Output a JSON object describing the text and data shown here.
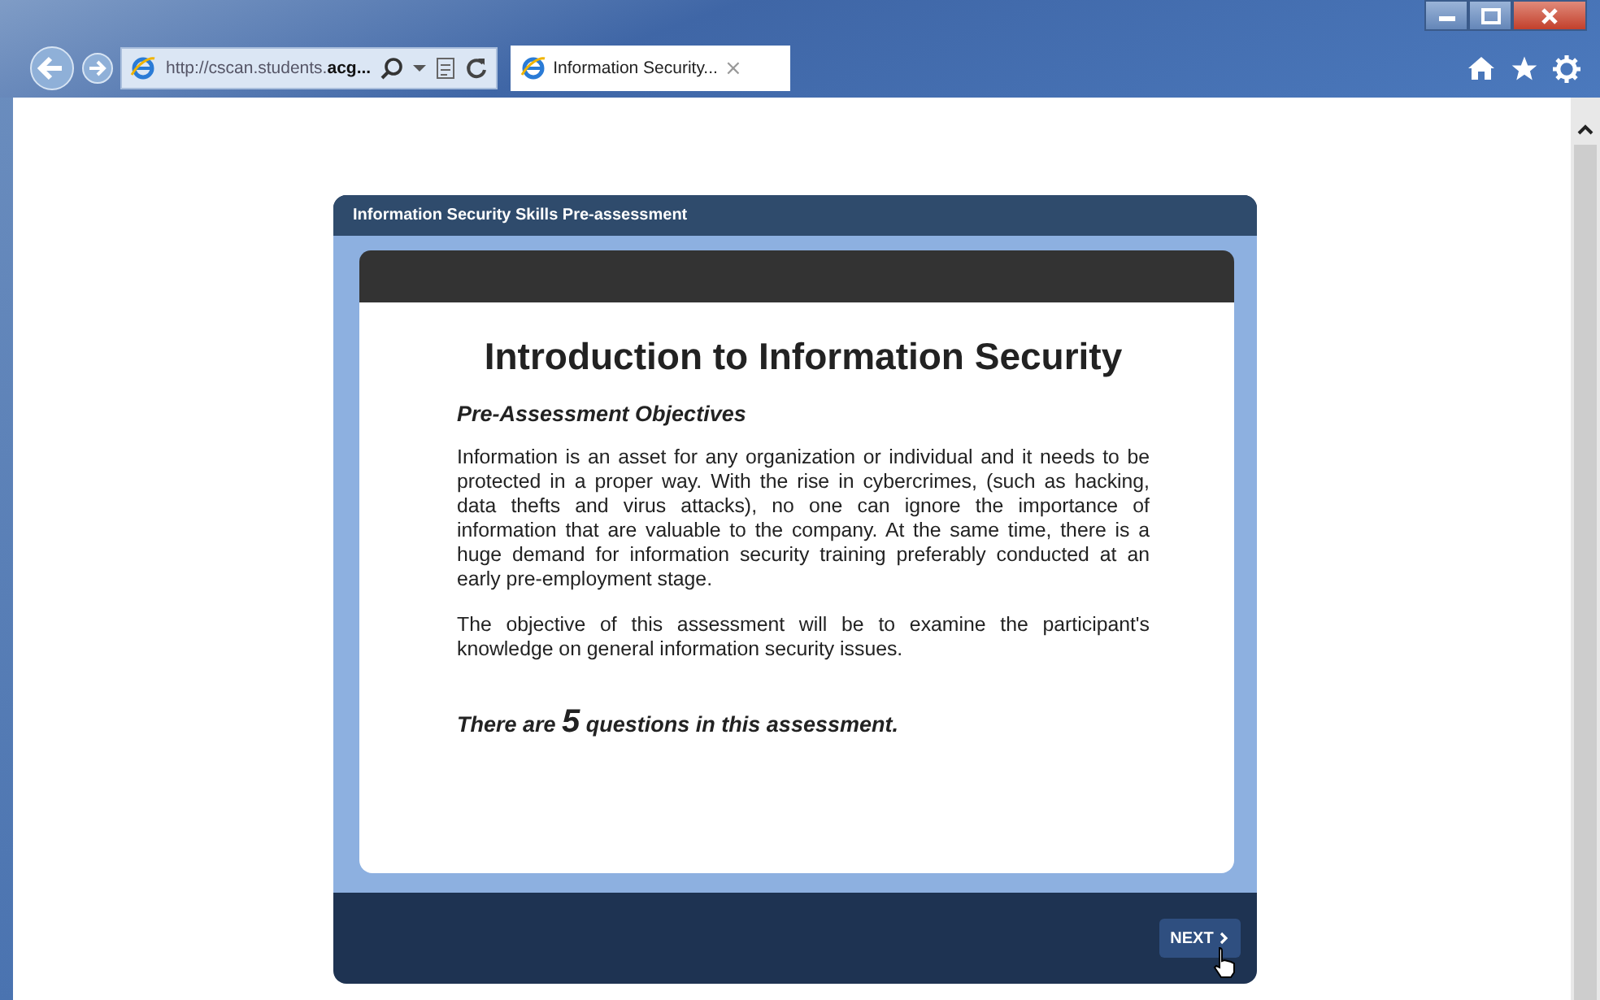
{
  "browser": {
    "address": "http://cscan.students.**acg...**",
    "tab": {
      "title": "Information Security...",
      "close": "×"
    }
  },
  "course": {
    "title": "Information Security Skills Pre-assessment",
    "heading": "Introduction to Information Security",
    "subheading": "Pre-Assessment Objectives",
    "paragraphs": [
      "Information is an asset for any organization or individual and it needs to be protected in a proper way. With the rise in cybercrimes, (such as hacking, data thefts and virus attacks), no one can ignore the importance of information that are valuable to the company. At the same time, there is a huge demand for information security training preferably conducted at an early pre-employment stage.",
      "The objective of this assessment will be to examine the participant's knowledge on general information security issues."
    ],
    "note": "There are **5** questions in this assessment.",
    "next_button": "NEXT"
  }
}
